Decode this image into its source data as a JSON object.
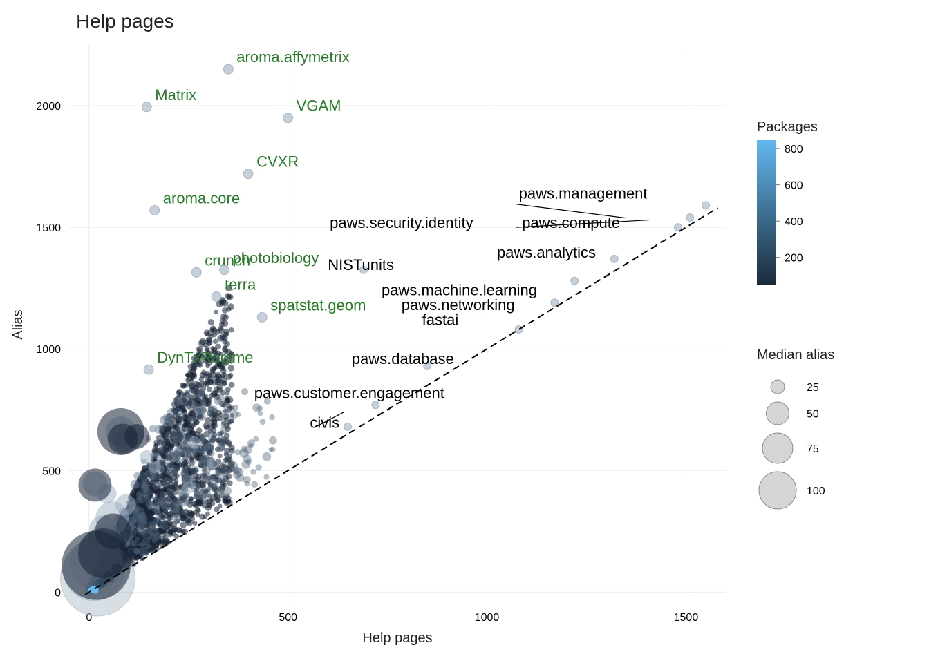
{
  "chart_data": {
    "type": "scatter",
    "title": "Help pages",
    "xlabel": "Help pages",
    "ylabel": "Alias",
    "xlim": [
      -50,
      1600
    ],
    "ylim": [
      -50,
      2250
    ],
    "xticks": [
      0,
      500,
      1000,
      1500
    ],
    "yticks": [
      0,
      500,
      1000,
      1500,
      2000
    ],
    "reference_line": {
      "slope": 1,
      "intercept": 0,
      "style": "dashed"
    },
    "annotations_green": [
      {
        "name": "aroma.affymetrix",
        "x": 350,
        "y": 2150
      },
      {
        "name": "Matrix",
        "x": 145,
        "y": 1995
      },
      {
        "name": "VGAM",
        "x": 500,
        "y": 1950
      },
      {
        "name": "CVXR",
        "x": 400,
        "y": 1720
      },
      {
        "name": "aroma.core",
        "x": 165,
        "y": 1570
      },
      {
        "name": "photobiology",
        "x": 340,
        "y": 1325
      },
      {
        "name": "crunch",
        "x": 270,
        "y": 1315
      },
      {
        "name": "terra",
        "x": 320,
        "y": 1215
      },
      {
        "name": "spatstat.geom",
        "x": 435,
        "y": 1130
      },
      {
        "name": "DynTxRegime",
        "x": 150,
        "y": 915
      }
    ],
    "annotations_black": [
      {
        "name": "paws.management",
        "x": 1550,
        "y": 1590,
        "lx": 1080,
        "ly": 1618
      },
      {
        "name": "paws.security.identity",
        "x": 1510,
        "y": 1540,
        "lx": 605,
        "ly": 1498
      },
      {
        "name": "paws.compute",
        "x": 1480,
        "y": 1500,
        "lx": 1088,
        "ly": 1498
      },
      {
        "name": "paws.analytics",
        "x": 1320,
        "y": 1370,
        "lx": 1025,
        "ly": 1375
      },
      {
        "name": "NISTunits",
        "x": 690,
        "y": 1325,
        "lx": 600,
        "ly": 1325
      },
      {
        "name": "paws.machine.learning",
        "x": 1220,
        "y": 1280,
        "lx": 735,
        "ly": 1220
      },
      {
        "name": "paws.networking",
        "x": 1170,
        "y": 1190,
        "lx": 785,
        "ly": 1160
      },
      {
        "name": "fastai",
        "x": 1080,
        "y": 1080,
        "lx": 837,
        "ly": 1098
      },
      {
        "name": "paws.database",
        "x": 850,
        "y": 930,
        "lx": 660,
        "ly": 938
      },
      {
        "name": "paws.customer.engagement",
        "x": 720,
        "y": 770,
        "lx": 415,
        "ly": 798
      },
      {
        "name": "civis",
        "x": 650,
        "y": 680,
        "lx": 555,
        "ly": 675
      }
    ],
    "leaders": [
      {
        "from": [
          570,
          680
        ],
        "to": [
          640,
          740
        ]
      },
      {
        "from": [
          1073,
          1595
        ],
        "to": [
          1350,
          1538
        ]
      },
      {
        "from": [
          1073,
          1500
        ],
        "to": [
          1408,
          1530
        ]
      }
    ],
    "cloud": {
      "description": "Dense mass of ~18 000 packages concentrated near origin; most x in [0,150], y in [0,300]; fan widens upward with y > x. A handful of large light points near (0-30, 50-150).",
      "points_sample": [
        {
          "x": 5,
          "y": 8,
          "s": 6,
          "c": 820
        },
        {
          "x": 10,
          "y": 12,
          "s": 6,
          "c": 780
        },
        {
          "x": 14,
          "y": 20,
          "s": 7,
          "c": 720
        },
        {
          "x": 20,
          "y": 24,
          "s": 7,
          "c": 650
        },
        {
          "x": 28,
          "y": 35,
          "s": 7,
          "c": 500
        },
        {
          "x": 35,
          "y": 42,
          "s": 7,
          "c": 380
        },
        {
          "x": 50,
          "y": 62,
          "s": 8,
          "c": 250
        },
        {
          "x": 70,
          "y": 95,
          "s": 8,
          "c": 160
        },
        {
          "x": 100,
          "y": 150,
          "s": 9,
          "c": 90
        },
        {
          "x": 18,
          "y": 110,
          "s": 50,
          "c": 40
        },
        {
          "x": 35,
          "y": 160,
          "s": 36,
          "c": 35
        },
        {
          "x": 60,
          "y": 250,
          "s": 26,
          "c": 25
        },
        {
          "x": 80,
          "y": 660,
          "s": 34,
          "c": 20
        },
        {
          "x": 85,
          "y": 630,
          "s": 22,
          "c": 18
        },
        {
          "x": 120,
          "y": 640,
          "s": 18,
          "c": 16
        },
        {
          "x": 15,
          "y": 440,
          "s": 24,
          "c": 15
        },
        {
          "x": 220,
          "y": 640,
          "s": 10,
          "c": 15
        }
      ]
    },
    "legends": {
      "color": {
        "title": "Packages",
        "ticks": [
          200,
          400,
          600,
          800
        ],
        "gradient_low": "#1b2a3a",
        "gradient_high": "#63b8f0"
      },
      "size": {
        "title": "Median alias",
        "items": [
          {
            "value": 25,
            "r": 10
          },
          {
            "value": 50,
            "r": 16.5
          },
          {
            "value": 75,
            "r": 22
          },
          {
            "value": 100,
            "r": 27
          }
        ]
      }
    }
  }
}
